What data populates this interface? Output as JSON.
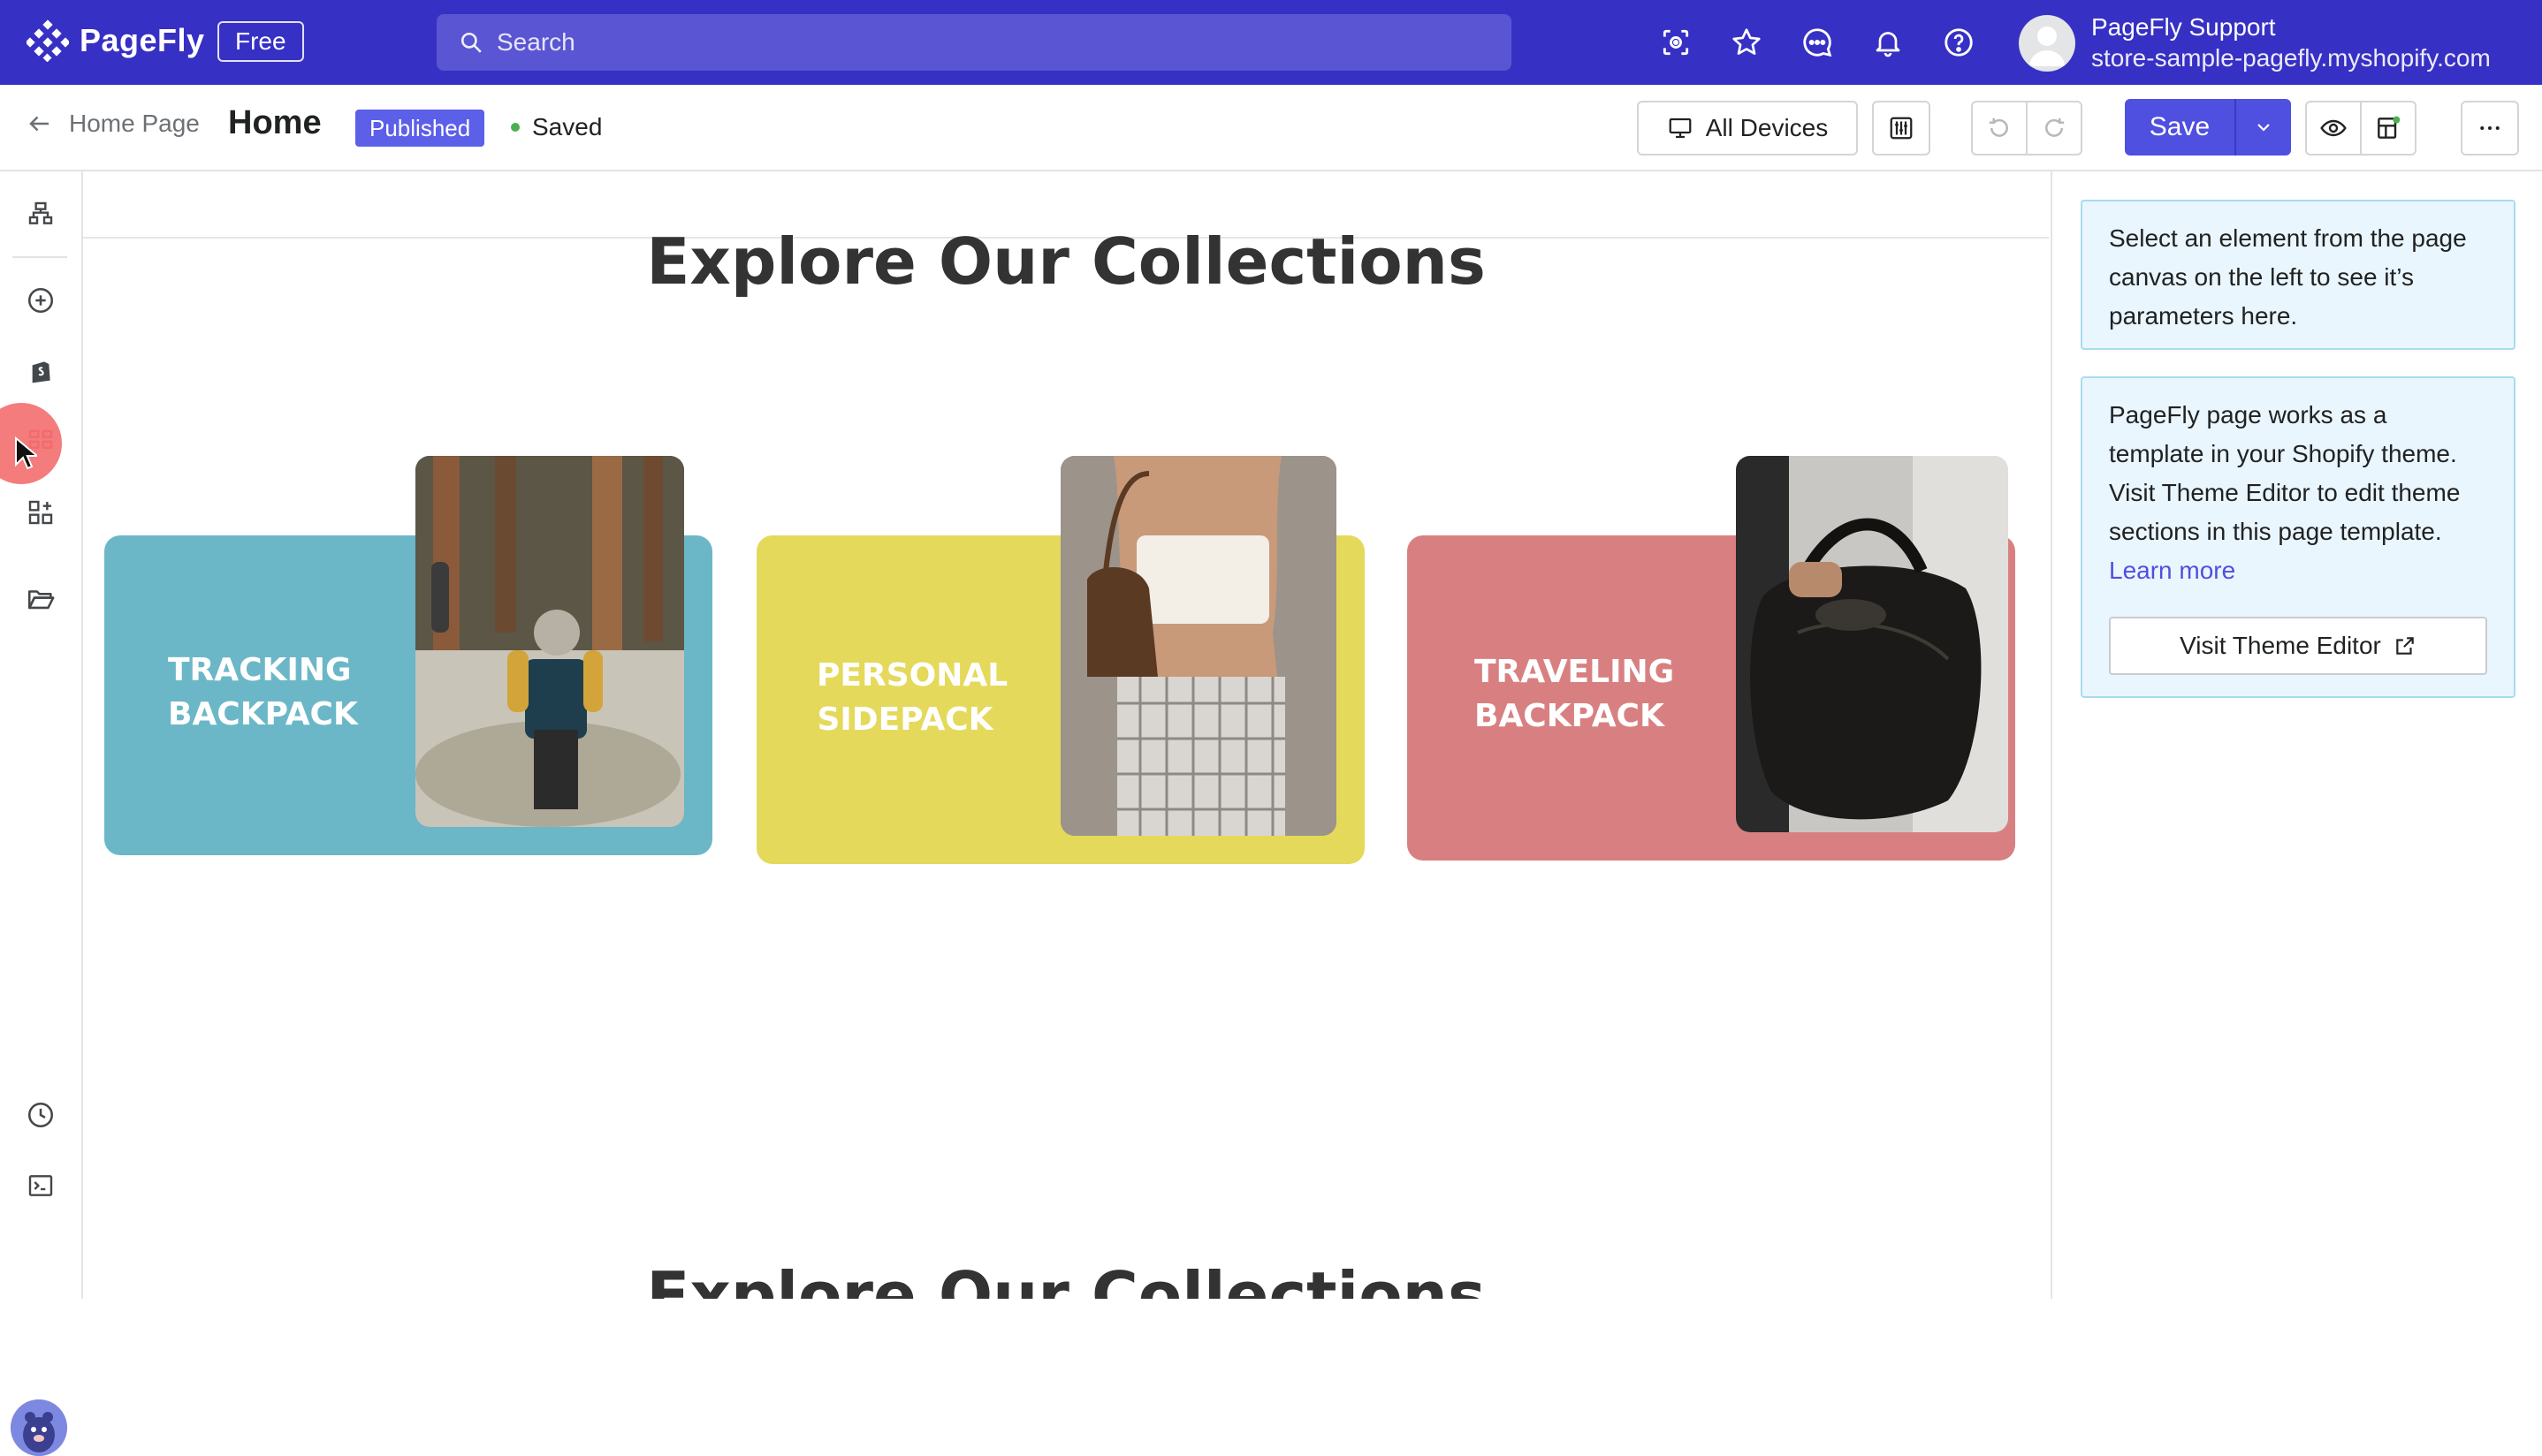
{
  "topbar": {
    "logo_text": "PageFly",
    "plan_badge": "Free",
    "search_placeholder": "Search",
    "icons": [
      "target-settings-icon",
      "star-icon",
      "chat-icon",
      "bell-icon",
      "help-icon"
    ],
    "user_name": "PageFly Support",
    "user_store": "store-sample-pagefly.myshopify.com"
  },
  "header": {
    "back_label": "Home Page",
    "page_title": "Home",
    "status_badge": "Published",
    "saved_label": "Saved",
    "devices_label": "All Devices",
    "save_label": "Save"
  },
  "sidebar": {
    "icons": [
      "layers-icon",
      "add-element-icon",
      "shopify-icon",
      "sections-grid-icon",
      "apps-icon",
      "folder-icon",
      "history-icon",
      "terminal-icon"
    ]
  },
  "canvas": {
    "section_title": "Explore Our Collections",
    "repeat_title": "Explore Our Collections",
    "cards": [
      {
        "label": "TRACKING\nBACKPACK",
        "color": "#6cb7c7"
      },
      {
        "label": "PERSONAL\nSIDEPACK",
        "color": "#e4d95a"
      },
      {
        "label": "TRAVELING\nBACKPACK",
        "color": "#d88081"
      }
    ]
  },
  "right_panel": {
    "select_hint": "Select an element from the page canvas on the left to see it’s parameters here.",
    "template_info": "PageFly page works as a template in your Shopify theme. Visit Theme Editor to edit theme sections in this page template.",
    "learn_more": "Learn more",
    "theme_button": "Visit Theme Editor"
  },
  "colors": {
    "topbar": "#3730c4",
    "accent": "#4f4fe0",
    "published_badge": "#5c5fe8",
    "info_bg": "#eaf6fd"
  }
}
